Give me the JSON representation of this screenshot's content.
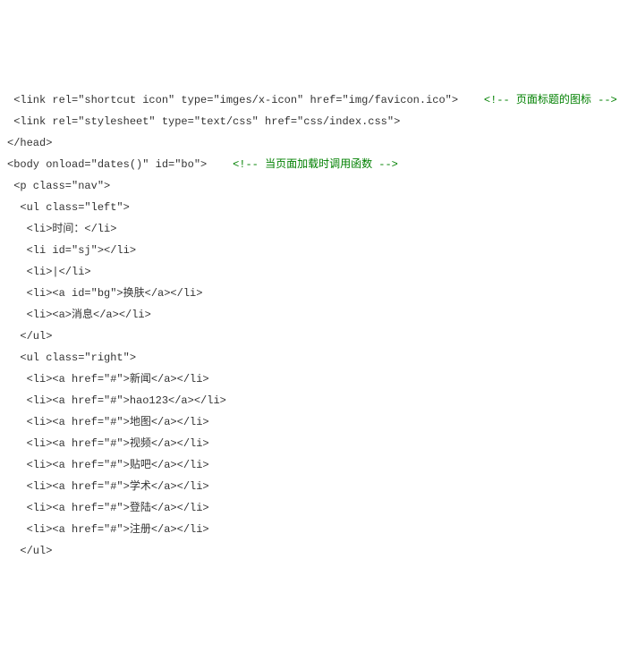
{
  "lines": [
    {
      "indent": 1,
      "text": "<link rel=\"shortcut icon\" type=\"imges/x-icon\" href=\"img/favicon.ico\">",
      "comment": "<!-- 页面标题的图标 -->"
    },
    {
      "indent": 1,
      "text": "<link rel=\"stylesheet\" type=\"text/css\" href=\"css/index.css\">",
      "comment": ""
    },
    {
      "indent": 0,
      "text": "</head>",
      "comment": ""
    },
    {
      "indent": 0,
      "text": "<body onload=\"dates()\" id=\"bo\">",
      "comment": "<!-- 当页面加载时调用函数 -->"
    },
    {
      "indent": 1,
      "text": "<p class=\"nav\">",
      "comment": ""
    },
    {
      "indent": 2,
      "text": "<ul class=\"left\">",
      "comment": ""
    },
    {
      "indent": 3,
      "text": "<li>时间：</li>",
      "comment": ""
    },
    {
      "indent": 3,
      "text": "<li id=\"sj\"></li>",
      "comment": ""
    },
    {
      "indent": 3,
      "text": "<li>|</li>",
      "comment": ""
    },
    {
      "indent": 3,
      "text": "<li><a id=\"bg\">换肤</a></li>",
      "comment": ""
    },
    {
      "indent": 3,
      "text": "<li><a>消息</a></li>",
      "comment": ""
    },
    {
      "indent": 2,
      "text": "</ul>",
      "comment": ""
    },
    {
      "indent": 2,
      "text": "<ul class=\"right\">",
      "comment": ""
    },
    {
      "indent": 3,
      "text": "<li><a href=\"#\">新闻</a></li>",
      "comment": ""
    },
    {
      "indent": 3,
      "text": "<li><a href=\"#\">hao123</a></li>",
      "comment": ""
    },
    {
      "indent": 3,
      "text": "<li><a href=\"#\">地图</a></li>",
      "comment": ""
    },
    {
      "indent": 3,
      "text": "<li><a href=\"#\">视频</a></li>",
      "comment": ""
    },
    {
      "indent": 3,
      "text": "<li><a href=\"#\">贴吧</a></li>",
      "comment": ""
    },
    {
      "indent": 3,
      "text": "<li><a href=\"#\">学术</a></li>",
      "comment": ""
    },
    {
      "indent": 3,
      "text": "<li><a href=\"#\">登陆</a></li>",
      "comment": ""
    },
    {
      "indent": 3,
      "text": "<li><a href=\"#\">注册</a></li>",
      "comment": ""
    },
    {
      "indent": 2,
      "text": "</ul>",
      "comment": ""
    }
  ],
  "gap": "    "
}
